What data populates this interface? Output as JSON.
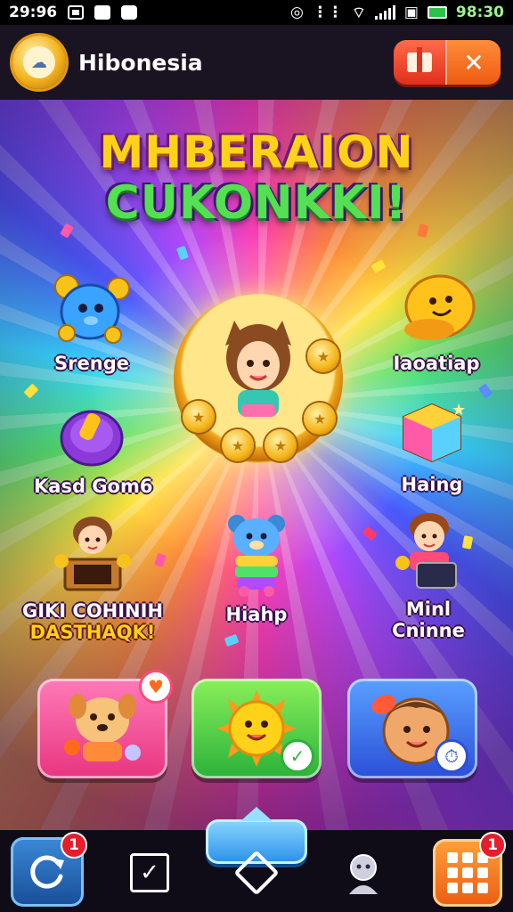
{
  "status_bar": {
    "time_left": "29:96",
    "time_right": "98:30"
  },
  "header": {
    "app_title": "Hibonesia",
    "gift_icon": "gift-icon",
    "close_icon": "close-icon",
    "close_glyph": "✕"
  },
  "banner": {
    "line1": "MHBERAION",
    "line2": "CUKONKKI!"
  },
  "games": {
    "left_top": {
      "label": "Srenge",
      "icon": "blue-creature-icon"
    },
    "right_top": {
      "label": "Iaoatiap",
      "icon": "yellow-blob-icon"
    },
    "left_mid": {
      "label": "Kasd Gom6",
      "icon": "purple-coin-icon"
    },
    "right_mid": {
      "label": "Haing",
      "icon": "gift-cube-icon"
    },
    "left_bottom": {
      "label": "GIKI COHINIH",
      "sublabel": "DASTHAQK!",
      "icon": "kid-box-icon"
    },
    "center_bottom": {
      "label": "Hiahp",
      "icon": "rainbow-bear-icon"
    },
    "right_bottom": {
      "label": "Minl",
      "sublabel": "Cninne",
      "icon": "kid-tablet-icon"
    }
  },
  "cards": [
    {
      "icon": "dog-character-icon",
      "badge_icon": "heart-icon",
      "color": "#e8357f"
    },
    {
      "icon": "sun-character-icon",
      "badge_icon": "check-icon",
      "color": "#2bb13a"
    },
    {
      "icon": "baby-character-icon",
      "badge_icon": "clock-icon",
      "color": "#2b4fd8"
    }
  ],
  "bottom_nav": {
    "notifications_badge": "1",
    "menu_badge": "1",
    "items": [
      "refresh-icon",
      "checkbox-icon",
      "home-diamond-icon",
      "profile-icon",
      "menu-grid-icon"
    ]
  },
  "colors": {
    "accent": "#ffd21a",
    "green": "#54e052",
    "header_bg": "#1a1322",
    "nav_bg": "#0f0c18"
  }
}
